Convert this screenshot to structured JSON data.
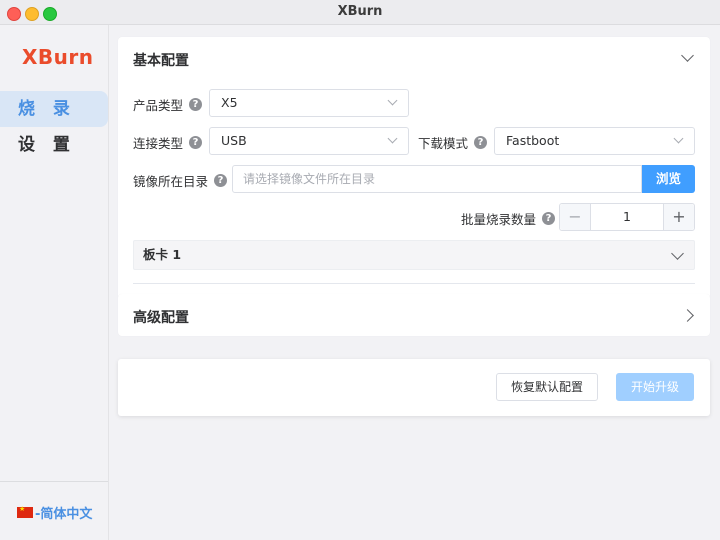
{
  "window": {
    "title": "XBurn"
  },
  "sidebar": {
    "logo": "XBurn",
    "items": [
      {
        "label": "烧 录",
        "active": true
      },
      {
        "label": "设 置",
        "active": false
      }
    ],
    "language": "-简体中文"
  },
  "basic_config": {
    "title": "基本配置",
    "product_type": {
      "label": "产品类型",
      "value": "X5"
    },
    "connection_type": {
      "label": "连接类型",
      "value": "USB"
    },
    "download_mode": {
      "label": "下载模式",
      "value": "Fastboot"
    },
    "image_dir": {
      "label": "镜像所在目录",
      "placeholder": "请选择镜像文件所在目录",
      "browse_label": "浏览"
    },
    "batch_count": {
      "label": "批量烧录数量",
      "value": "1",
      "minus": "−",
      "plus": "+"
    },
    "board": {
      "title": "板卡 1"
    }
  },
  "advanced_config": {
    "title": "高级配置"
  },
  "actions": {
    "reset_label": "恢复默认配置",
    "start_label": "开始升级"
  },
  "colors": {
    "accent": "#409eff",
    "logo": "#ea4c2c",
    "nav_active_bg": "#d9e6f6",
    "start_disabled": "#a0cfff"
  }
}
